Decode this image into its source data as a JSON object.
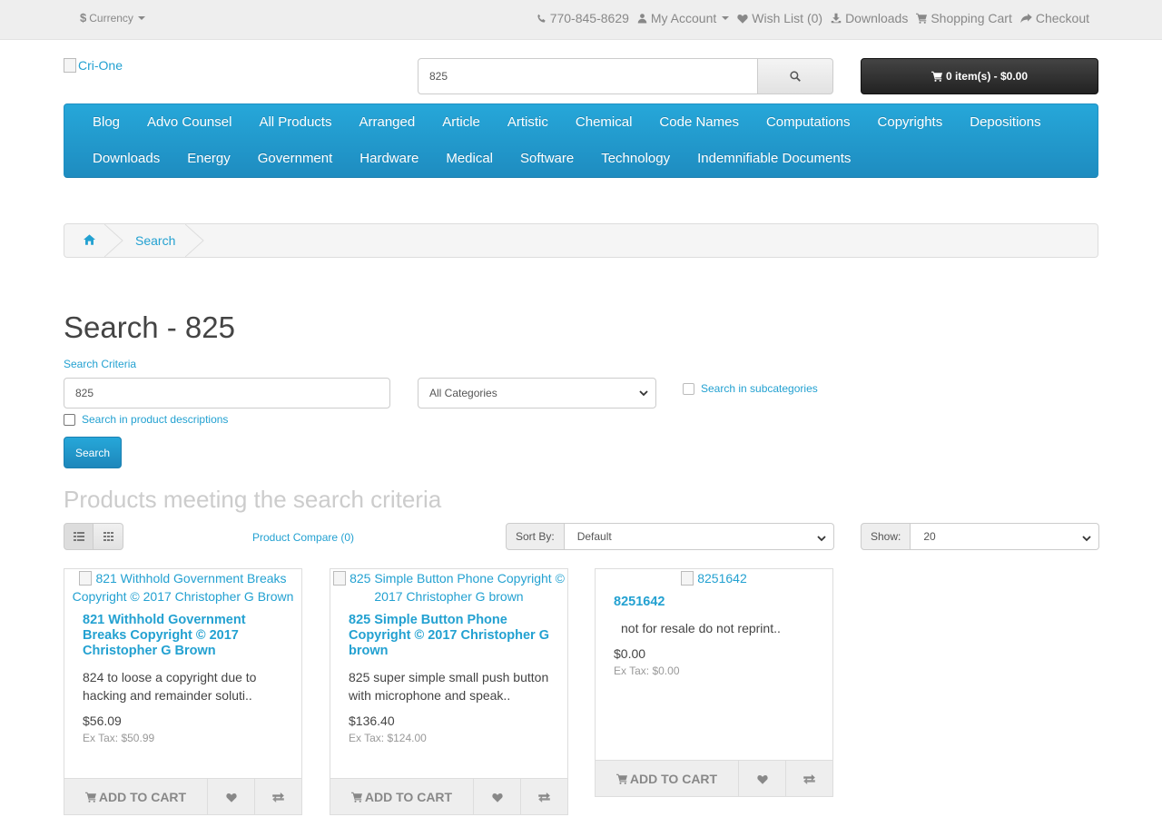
{
  "topbar": {
    "currency_label": "Currency",
    "phone": "770-845-8629",
    "my_account": "My Account",
    "wish_list": "Wish List (0)",
    "downloads": "Downloads",
    "shopping_cart": "Shopping Cart",
    "checkout": "Checkout"
  },
  "header": {
    "logo_alt": "Cri-One",
    "search_value": "825",
    "cart_label": "0 item(s) - $0.00"
  },
  "menu": {
    "row1": [
      "Blog",
      "Advo Counsel",
      "All Products",
      "Arranged",
      "Article",
      "Artistic",
      "Chemical",
      "Code Names",
      "Computations",
      "Copyrights",
      "Depositions"
    ],
    "row2": [
      "Downloads",
      "Energy",
      "Government",
      "Hardware",
      "Medical",
      "Software",
      "Technology",
      "Indemnifiable Documents"
    ]
  },
  "breadcrumb": {
    "current": "Search"
  },
  "search": {
    "page_title": "Search - 825",
    "criteria_label": "Search Criteria",
    "criteria_value": "825",
    "category": "All Categories",
    "subcategories_label": "Search in subcategories",
    "descriptions_label": "Search in product descriptions",
    "button": "Search"
  },
  "results": {
    "title": "Products meeting the search criteria",
    "compare": "Product Compare (0)",
    "sort_label": "Sort By:",
    "sort_value": "Default",
    "show_label": "Show:",
    "show_value": "20"
  },
  "products": [
    {
      "image_alt": "821 Withhold Government Breaks Copyright © 2017 Christopher G Brown",
      "name": "821 Withhold Government Breaks Copyright © 2017 Christopher G Brown",
      "description": "824 to loose a copyright due to hacking and remainder soluti..",
      "price": "$56.09",
      "ex_tax": "Ex Tax: $50.99",
      "add_to_cart": "ADD TO CART"
    },
    {
      "image_alt": "825 Simple Button Phone Copyright © 2017 Christopher G brown",
      "name": "825 Simple Button Phone Copyright © 2017 Christopher G brown",
      "description": "825 super simple small push button with microphone and speak..",
      "price": "$136.40",
      "ex_tax": "Ex Tax: $124.00",
      "add_to_cart": "ADD TO CART"
    },
    {
      "image_alt": "8251642",
      "name": "8251642",
      "description": "not for resale do not reprint..",
      "price": "$0.00",
      "ex_tax": "Ex Tax: $0.00",
      "add_to_cart": "ADD TO CART"
    }
  ]
}
